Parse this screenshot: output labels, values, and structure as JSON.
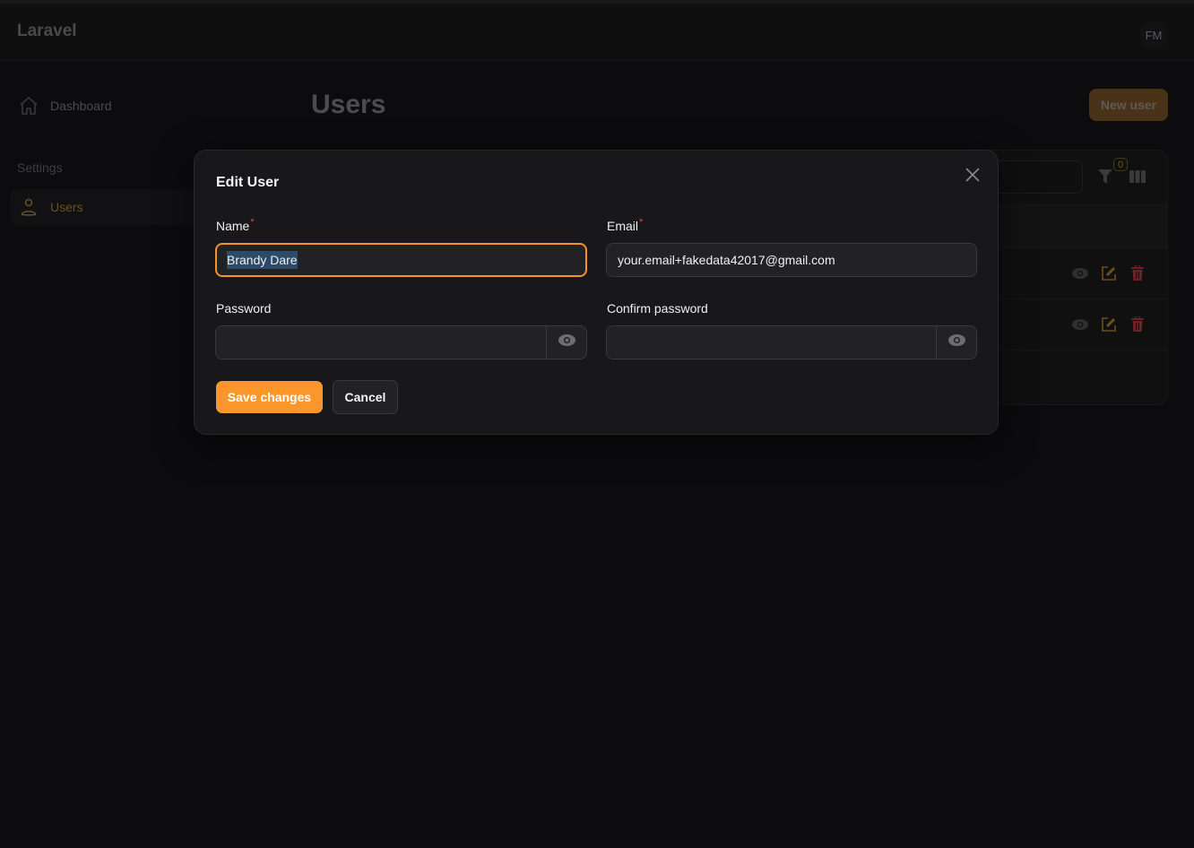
{
  "app": {
    "brand": "Laravel",
    "user_initials": "FM"
  },
  "sidebar": {
    "items": [
      {
        "label": "Dashboard",
        "icon": "home-icon",
        "active": false
      },
      {
        "label": "Users",
        "icon": "user-icon",
        "active": true
      }
    ],
    "group_label": "Settings"
  },
  "page": {
    "title": "Users",
    "new_button_label": "New user",
    "filter_count": "0",
    "rows": [
      {
        "actions": [
          "view-icon",
          "edit-icon",
          "delete-icon"
        ]
      },
      {
        "actions": [
          "view-icon",
          "edit-icon",
          "delete-icon"
        ]
      }
    ]
  },
  "modal": {
    "title": "Edit User",
    "fields": {
      "name": {
        "label": "Name",
        "required_mark": "*",
        "value": "Brandy Dare"
      },
      "email": {
        "label": "Email",
        "required_mark": "*",
        "value": "your.email+fakedata42017@gmail.com"
      },
      "password": {
        "label": "Password",
        "value": ""
      },
      "confirm_password": {
        "label": "Confirm password",
        "value": ""
      }
    },
    "save_label": "Save changes",
    "cancel_label": "Cancel"
  },
  "colors": {
    "primary": "#fb962b",
    "danger": "#ef4444",
    "selection": "#2d4a68"
  }
}
